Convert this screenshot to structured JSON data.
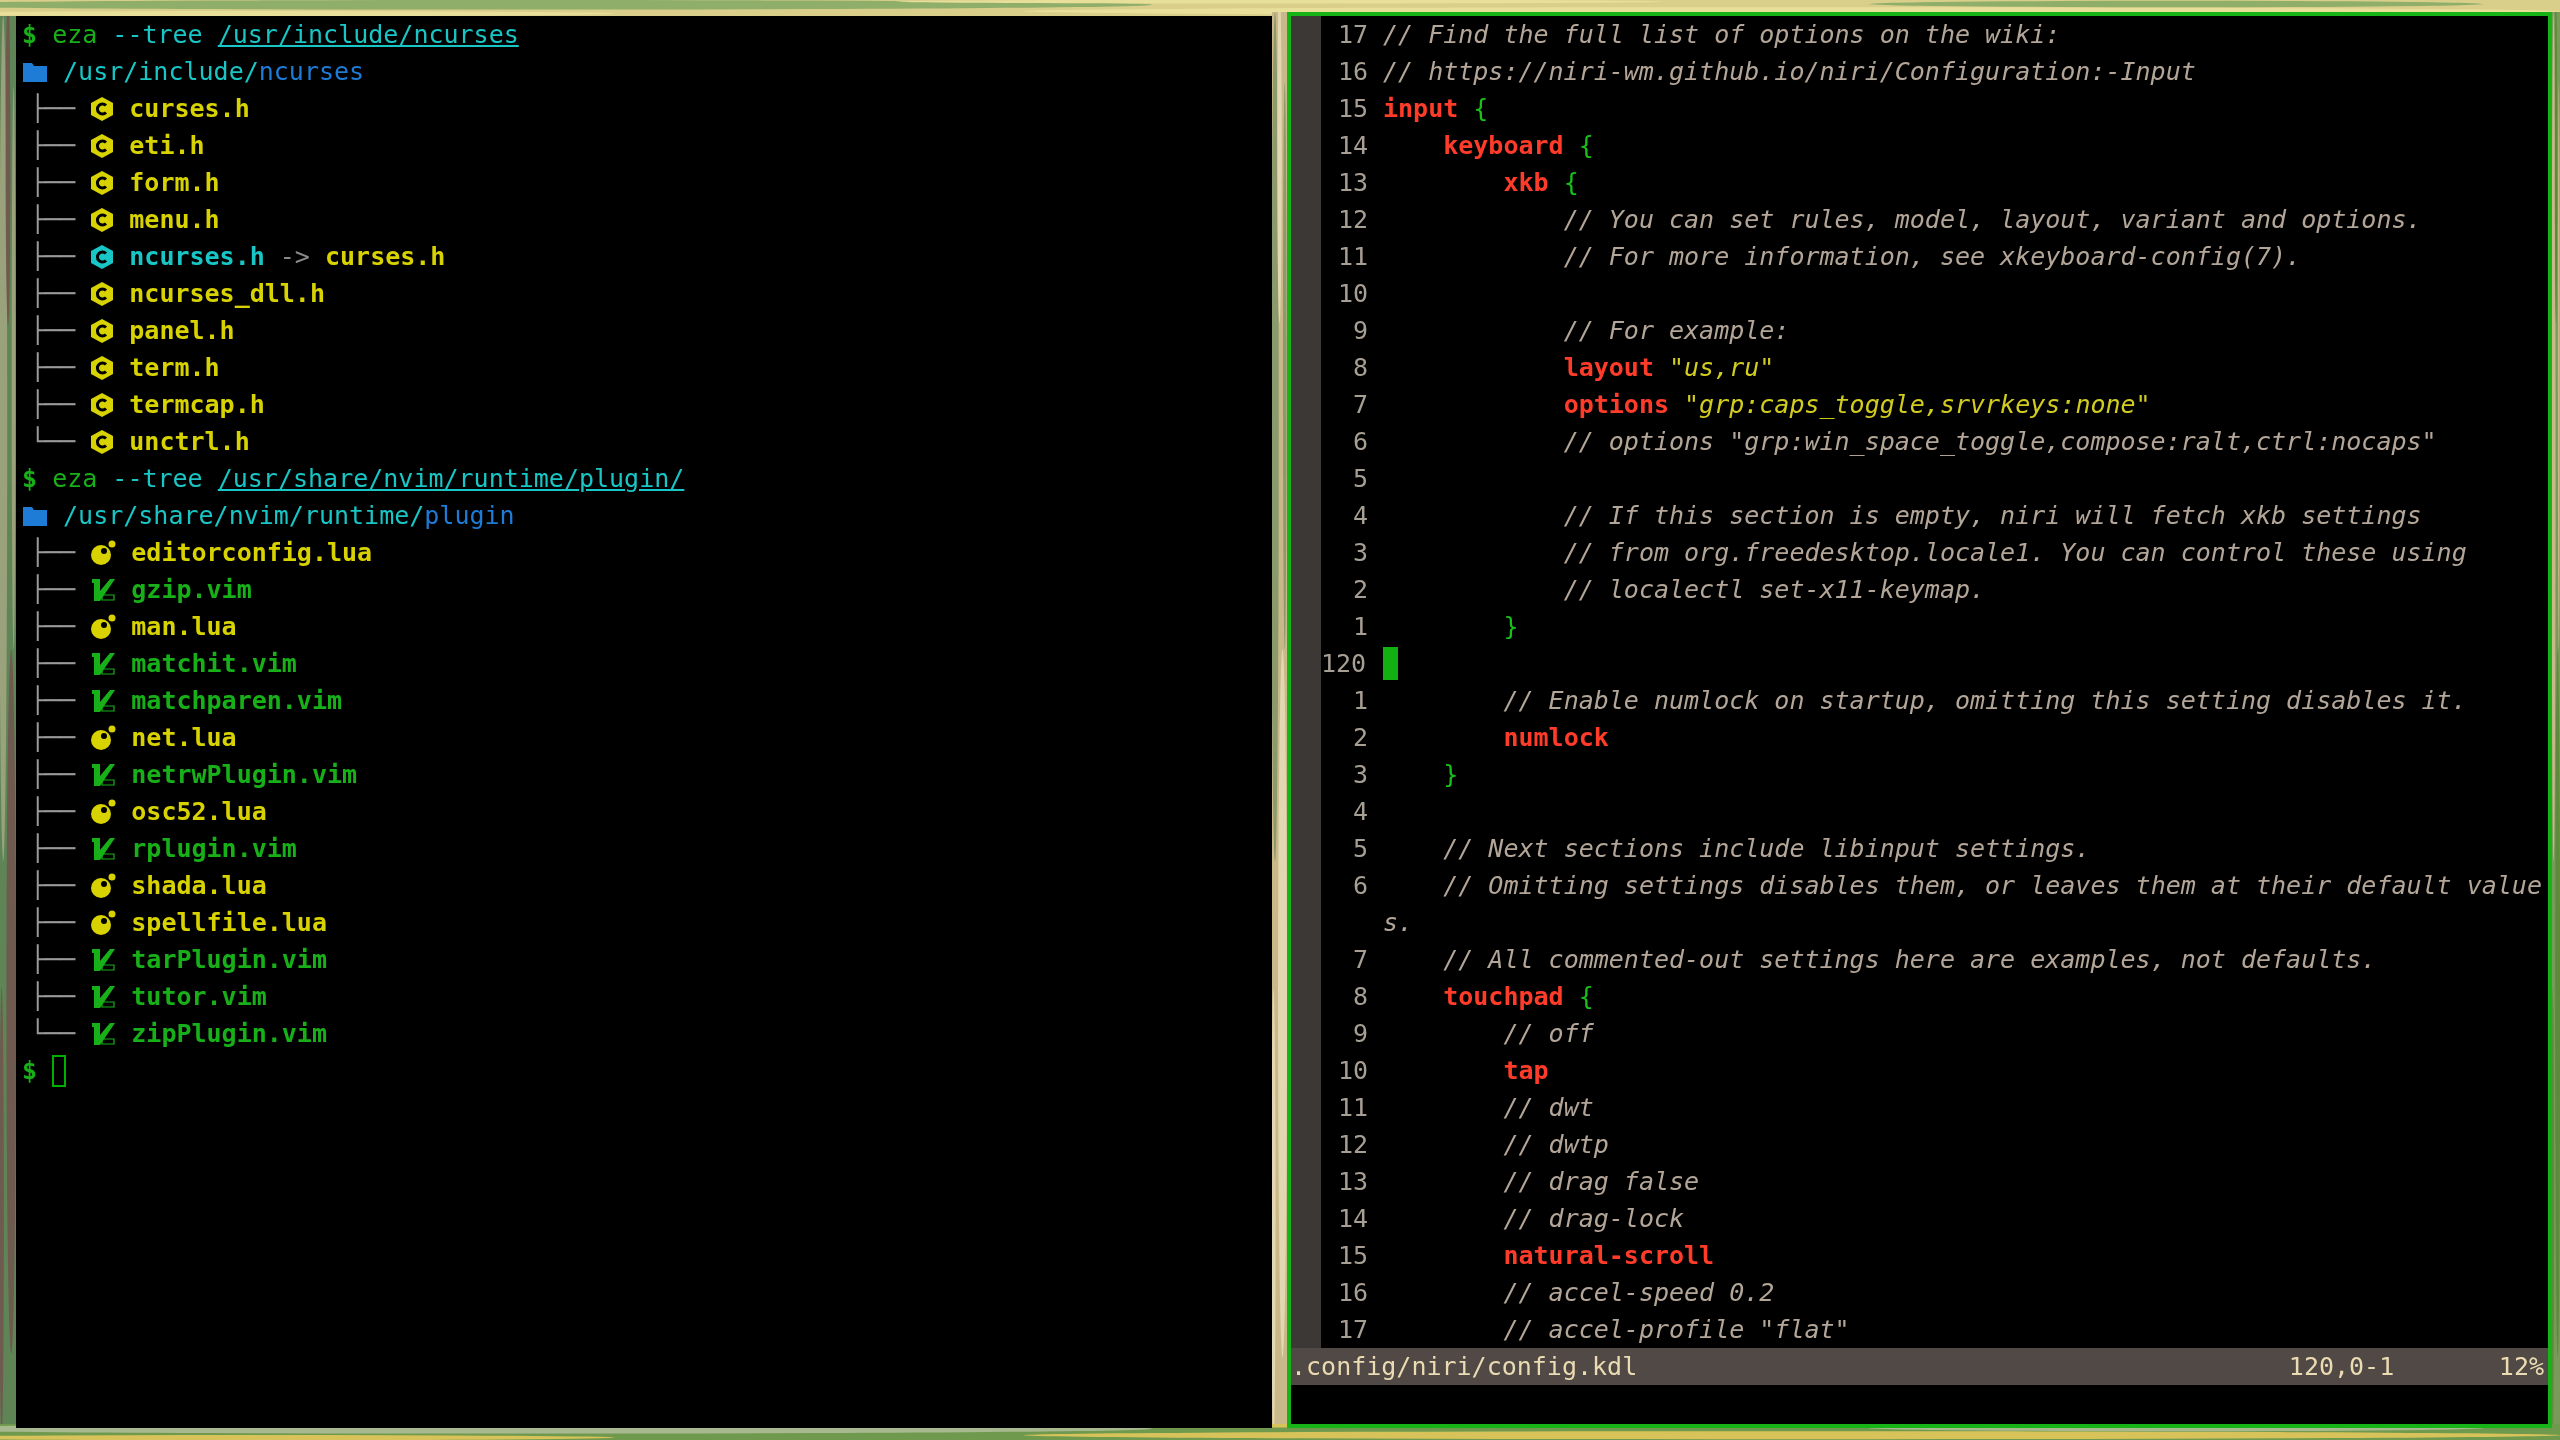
{
  "terminal": {
    "blocks": [
      {
        "prompt": "$",
        "command": "eza",
        "flag": "--tree",
        "path": "/usr/include/ncurses",
        "root": {
          "parent": "/usr/include/",
          "name": "ncurses",
          "children": [
            {
              "branch": "├──",
              "kind": "c",
              "name": "curses.h"
            },
            {
              "branch": "├──",
              "kind": "c",
              "name": "eti.h"
            },
            {
              "branch": "├──",
              "kind": "c",
              "name": "form.h"
            },
            {
              "branch": "├──",
              "kind": "c",
              "name": "menu.h"
            },
            {
              "branch": "├──",
              "kind": "symlink",
              "name": "ncurses.h",
              "arrow": "->",
              "target": "curses.h"
            },
            {
              "branch": "├──",
              "kind": "c",
              "name": "ncurses_dll.h"
            },
            {
              "branch": "├──",
              "kind": "c",
              "name": "panel.h"
            },
            {
              "branch": "├──",
              "kind": "c",
              "name": "term.h"
            },
            {
              "branch": "├──",
              "kind": "c",
              "name": "termcap.h"
            },
            {
              "branch": "└──",
              "kind": "c",
              "name": "unctrl.h"
            }
          ]
        }
      },
      {
        "prompt": "$",
        "command": "eza",
        "flag": "--tree",
        "path": "/usr/share/nvim/runtime/plugin/",
        "root": {
          "parent": "/usr/share/nvim/runtime/",
          "name": "plugin",
          "children": [
            {
              "branch": "├──",
              "kind": "lua",
              "name": "editorconfig.lua"
            },
            {
              "branch": "├──",
              "kind": "vim",
              "name": "gzip.vim"
            },
            {
              "branch": "├──",
              "kind": "lua",
              "name": "man.lua"
            },
            {
              "branch": "├──",
              "kind": "vim",
              "name": "matchit.vim"
            },
            {
              "branch": "├──",
              "kind": "vim",
              "name": "matchparen.vim"
            },
            {
              "branch": "├──",
              "kind": "lua",
              "name": "net.lua"
            },
            {
              "branch": "├──",
              "kind": "vim",
              "name": "netrwPlugin.vim"
            },
            {
              "branch": "├──",
              "kind": "lua",
              "name": "osc52.lua"
            },
            {
              "branch": "├──",
              "kind": "vim",
              "name": "rplugin.vim"
            },
            {
              "branch": "├──",
              "kind": "lua",
              "name": "shada.lua"
            },
            {
              "branch": "├──",
              "kind": "lua",
              "name": "spellfile.lua"
            },
            {
              "branch": "├──",
              "kind": "vim",
              "name": "tarPlugin.vim"
            },
            {
              "branch": "├──",
              "kind": "vim",
              "name": "tutor.vim"
            },
            {
              "branch": "└──",
              "kind": "vim",
              "name": "zipPlugin.vim"
            }
          ]
        }
      }
    ],
    "prompt": "$"
  },
  "editor": {
    "lines": [
      {
        "number": "17",
        "tokens": [
          {
            "kind": "comment",
            "text": "// Find the full list of options on the wiki:"
          }
        ]
      },
      {
        "number": "16",
        "tokens": [
          {
            "kind": "comment",
            "text": "// https://niri-wm.github.io/niri/Configuration:-Input"
          }
        ]
      },
      {
        "number": "15",
        "tokens": [
          {
            "kind": "keyword",
            "text": "input"
          },
          {
            "kind": "brace",
            "text": " {"
          }
        ]
      },
      {
        "number": "14",
        "tokens": [
          {
            "kind": "keyword",
            "text": "    keyboard"
          },
          {
            "kind": "brace",
            "text": " {"
          }
        ]
      },
      {
        "number": "13",
        "tokens": [
          {
            "kind": "keyword",
            "text": "        xkb"
          },
          {
            "kind": "brace",
            "text": " {"
          }
        ]
      },
      {
        "number": "12",
        "tokens": [
          {
            "kind": "comment",
            "text": "            // You can set rules, model, layout, variant and options."
          }
        ]
      },
      {
        "number": "11",
        "tokens": [
          {
            "kind": "comment",
            "text": "            // For more information, see xkeyboard-config(7)."
          }
        ]
      },
      {
        "number": "10"
      },
      {
        "number": "9",
        "tokens": [
          {
            "kind": "comment",
            "text": "            // For example:"
          }
        ]
      },
      {
        "number": "8",
        "tokens": [
          {
            "kind": "keyword",
            "text": "            layout"
          },
          {
            "kind": "string",
            "text": " \"us,ru\""
          }
        ]
      },
      {
        "number": "7",
        "tokens": [
          {
            "kind": "keyword",
            "text": "            options"
          },
          {
            "kind": "string",
            "text": " \"grp:caps_toggle,srvrkeys:none\""
          }
        ]
      },
      {
        "number": "6",
        "tokens": [
          {
            "kind": "comment",
            "text": "            // options \"grp:win_space_toggle,compose:ralt,ctrl:nocaps\""
          }
        ]
      },
      {
        "number": "5"
      },
      {
        "number": "4",
        "tokens": [
          {
            "kind": "comment",
            "text": "            // If this section is empty, niri will fetch xkb settings"
          }
        ]
      },
      {
        "number": "3",
        "tokens": [
          {
            "kind": "comment",
            "text": "            // from org.freedesktop.locale1. You can control these using"
          }
        ]
      },
      {
        "number": "2",
        "tokens": [
          {
            "kind": "comment",
            "text": "            // localectl set-x11-keymap."
          }
        ]
      },
      {
        "number": "1",
        "tokens": [
          {
            "kind": "brace",
            "text": "        }"
          }
        ]
      },
      {
        "number": "120",
        "current": true
      },
      {
        "number": "1",
        "tokens": [
          {
            "kind": "comment",
            "text": "        // Enable numlock on startup, omitting this setting disables it."
          }
        ]
      },
      {
        "number": "2",
        "tokens": [
          {
            "kind": "keyword",
            "text": "        numlock"
          }
        ]
      },
      {
        "number": "3",
        "tokens": [
          {
            "kind": "brace",
            "text": "    }"
          }
        ]
      },
      {
        "number": "4"
      },
      {
        "number": "5",
        "tokens": [
          {
            "kind": "comment",
            "text": "    // Next sections include libinput settings."
          }
        ]
      },
      {
        "number": "6",
        "tokens": [
          {
            "kind": "comment",
            "text": "    // Omitting settings disables them, or leaves them at their default value"
          }
        ]
      },
      {
        "tokens": [
          {
            "kind": "comment",
            "text": "s."
          }
        ]
      },
      {
        "number": "7",
        "tokens": [
          {
            "kind": "comment",
            "text": "    // All commented-out settings here are examples, not defaults."
          }
        ]
      },
      {
        "number": "8",
        "tokens": [
          {
            "kind": "keyword",
            "text": "    touchpad"
          },
          {
            "kind": "brace",
            "text": " {"
          }
        ]
      },
      {
        "number": "9",
        "tokens": [
          {
            "kind": "comment",
            "text": "        // off"
          }
        ]
      },
      {
        "number": "10",
        "tokens": [
          {
            "kind": "keyword",
            "text": "        tap"
          }
        ]
      },
      {
        "number": "11",
        "tokens": [
          {
            "kind": "comment",
            "text": "        // dwt"
          }
        ]
      },
      {
        "number": "12",
        "tokens": [
          {
            "kind": "comment",
            "text": "        // dwtp"
          }
        ]
      },
      {
        "number": "13",
        "tokens": [
          {
            "kind": "comment",
            "text": "        // drag false"
          }
        ]
      },
      {
        "number": "14",
        "tokens": [
          {
            "kind": "comment",
            "text": "        // drag-lock"
          }
        ]
      },
      {
        "number": "15",
        "tokens": [
          {
            "kind": "keyword",
            "text": "        natural-scroll"
          }
        ]
      },
      {
        "number": "16",
        "tokens": [
          {
            "kind": "comment",
            "text": "        // accel-speed 0.2"
          }
        ]
      },
      {
        "number": "17",
        "tokens": [
          {
            "kind": "comment",
            "text": "        // accel-profile \"flat\""
          }
        ]
      }
    ],
    "status_bar": {
      "file": ".config/niri/config.kdl",
      "position": "120,0-1",
      "percent": "12%"
    }
  }
}
